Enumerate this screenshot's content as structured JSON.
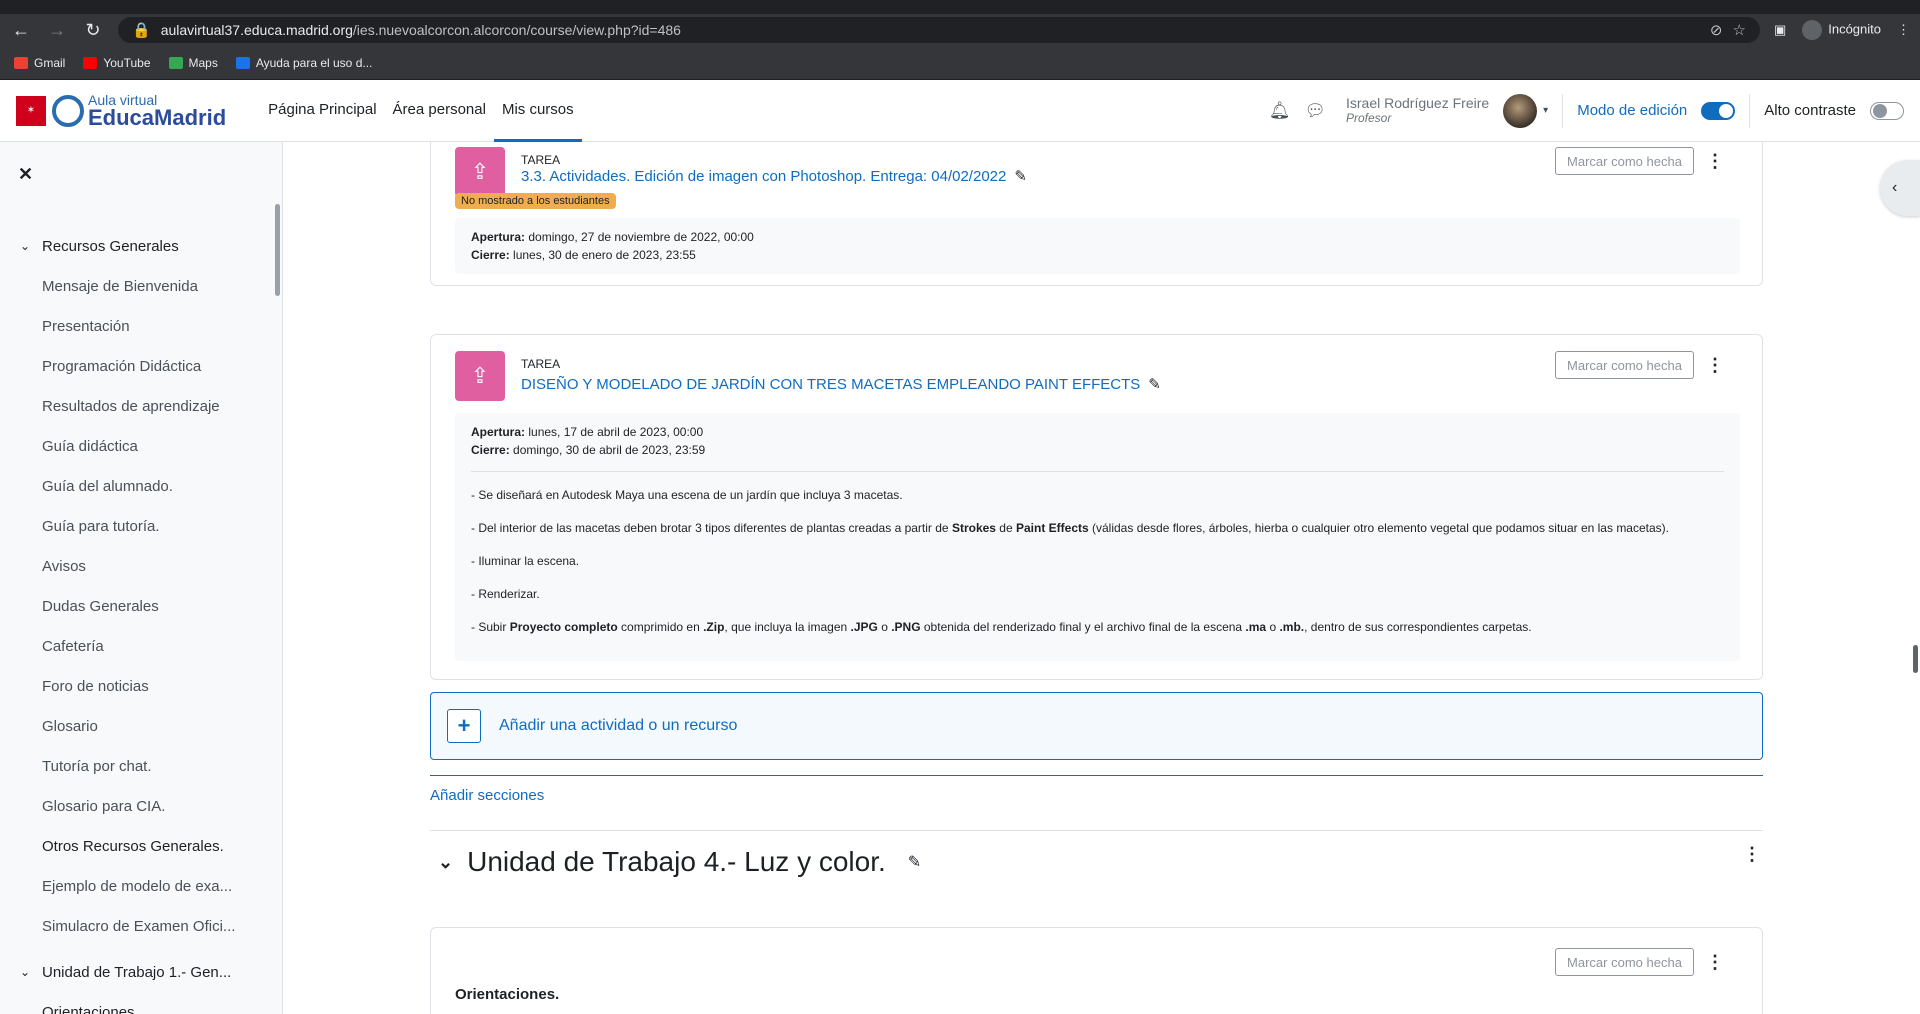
{
  "browser": {
    "url_host": "aulavirtual37.educa.madrid.org",
    "url_path": "/ies.nuevoalcorcon.alcorcon/course/view.php?id=486",
    "profile_label": "Incógnito",
    "bookmarks": [
      "Gmail",
      "YouTube",
      "Maps",
      "Ayuda para el uso d..."
    ]
  },
  "navbar": {
    "logo_small": "Aula virtual",
    "logo_big": "EducaMadrid",
    "links": [
      "Página Principal",
      "Área personal",
      "Mis cursos"
    ],
    "user_name": "Israel Rodríguez Freire",
    "user_role": "Profesor",
    "edit_mode_label": "Modo de edición",
    "edit_mode_on": true,
    "contrast_label": "Alto contraste",
    "contrast_on": false
  },
  "drawer": {
    "items": [
      {
        "label": "Recursos Generales",
        "section": true
      },
      {
        "label": "Mensaje de Bienvenida"
      },
      {
        "label": "Presentación"
      },
      {
        "label": "Programación Didáctica"
      },
      {
        "label": "Resultados de aprendizaje"
      },
      {
        "label": "Guía didáctica"
      },
      {
        "label": "Guía del alumnado."
      },
      {
        "label": "Guía para tutoría."
      },
      {
        "label": "Avisos"
      },
      {
        "label": "Dudas Generales"
      },
      {
        "label": "Cafetería"
      },
      {
        "label": "Foro de noticias"
      },
      {
        "label": "Glosario"
      },
      {
        "label": "Tutoría por chat."
      },
      {
        "label": "Glosario para CIA."
      },
      {
        "label": "Otros Recursos Generales."
      },
      {
        "label": "Ejemplo de modelo de exa..."
      },
      {
        "label": "Simulacro de Examen Ofici..."
      },
      {
        "label": "Unidad de Trabajo 1.- Gen...",
        "section": true
      },
      {
        "label": "Orientaciones."
      }
    ]
  },
  "activities": {
    "a1": {
      "type": "TAREA",
      "title": "3.3. Actividades. Edición de imagen con Photoshop. Entrega: 04/02/2022",
      "badge": "No mostrado a los estudiantes",
      "mark_label": "Marcar como hecha",
      "open_label": "Apertura:",
      "open_value": " domingo, 27 de noviembre de 2022, 00:00",
      "close_label": "Cierre:",
      "close_value": " lunes, 30 de enero de 2023, 23:55"
    },
    "a2": {
      "type": "TAREA",
      "title": "DISEÑO Y MODELADO DE JARDÍN CON TRES MACETAS EMPLEANDO PAINT EFFECTS",
      "mark_label": "Marcar como hecha",
      "open_label": "Apertura:",
      "open_value": " lunes, 17 de abril de 2023, 00:00",
      "close_label": "Cierre:",
      "close_value": " domingo, 30 de abril de 2023, 23:59",
      "desc1": "- Se diseñará en Autodesk Maya una escena de un jardín que incluya 3 macetas.",
      "desc2_a": "- Del interior de las macetas deben brotar 3 tipos diferentes de plantas creadas a partir de ",
      "desc2_b": "Strokes",
      "desc2_c": " de ",
      "desc2_d": "Paint Effects",
      "desc2_e": " (válidas desde flores, árboles, hierba o cualquier otro elemento vegetal que podamos situar en las macetas).",
      "desc3": "- Iluminar la escena.",
      "desc4": "- Renderizar.",
      "desc5_a": "- Subir ",
      "desc5_b": "Proyecto completo",
      "desc5_c": " comprimido en ",
      "desc5_d": ".Zip",
      "desc5_e": ", que incluya la imagen ",
      "desc5_f": ".JPG",
      "desc5_g": " o ",
      "desc5_h": ".PNG",
      "desc5_i": " obtenida del renderizado final y el archivo final de la escena ",
      "desc5_j": ".ma",
      "desc5_k": " o ",
      "desc5_l": ".mb.",
      "desc5_m": ", dentro de sus correspondientes carpetas."
    },
    "a3": {
      "title": "Orientaciones.",
      "mark_label": "Marcar como hecha"
    }
  },
  "add_activity_label": "Añadir una actividad o un recurso",
  "add_sections_label": "Añadir secciones",
  "section_title": "Unidad de Trabajo 4.- Luz y color."
}
